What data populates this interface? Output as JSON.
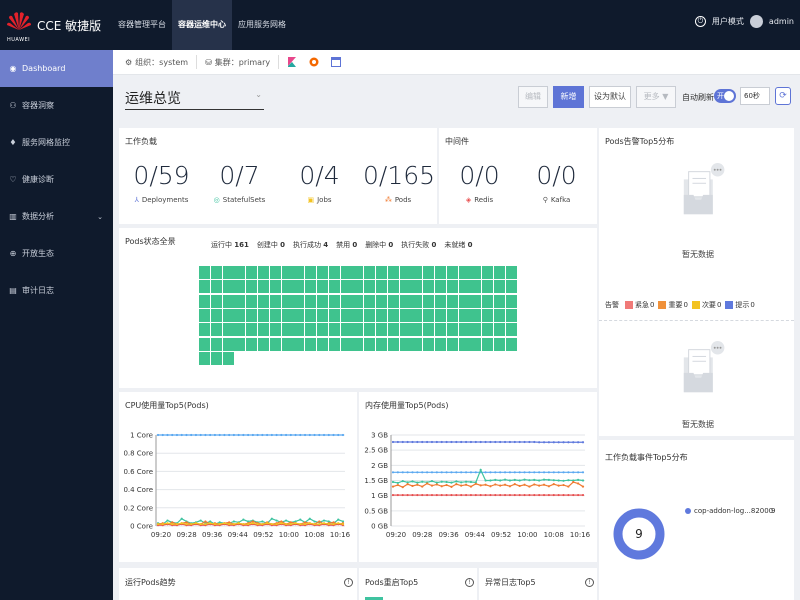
{
  "brand": {
    "logo_text": "HUAWEI",
    "title": "CCE 敏捷版"
  },
  "topnav": [
    {
      "label": "容器管理平台",
      "active": false
    },
    {
      "label": "容器运维中心",
      "active": true
    },
    {
      "label": "应用服务网格",
      "active": false
    }
  ],
  "top_right": {
    "user_mode": "用户模式",
    "username": "admin"
  },
  "sidebar": [
    {
      "label": "Dashboard",
      "icon": "dashboard-icon",
      "active": true
    },
    {
      "label": "容器洞察",
      "icon": "insight-icon"
    },
    {
      "label": "服务网格监控",
      "icon": "mesh-icon"
    },
    {
      "label": "健康诊断",
      "icon": "health-icon"
    },
    {
      "label": "数据分析",
      "icon": "chart-icon",
      "chevron": true
    },
    {
      "label": "开放生态",
      "icon": "ecosystem-icon"
    },
    {
      "label": "审计日志",
      "icon": "audit-icon"
    }
  ],
  "context": {
    "org": "组织：system",
    "cluster": "集群：primary"
  },
  "header": {
    "page_title": "运维总览",
    "edit": "编辑",
    "add": "新增",
    "set_default": "设为默认",
    "more": "更多",
    "auto_refresh": "自动刷新",
    "toggle": "开",
    "interval": "60秒"
  },
  "workload": {
    "title": "工作负载",
    "items": [
      {
        "value": "0/59",
        "label": "Deployments"
      },
      {
        "value": "0/7",
        "label": "StatefulSets"
      },
      {
        "value": "0/4",
        "label": "Jobs"
      },
      {
        "value": "0/165",
        "label": "Pods"
      }
    ]
  },
  "middleware": {
    "title": "中间件",
    "items": [
      {
        "value": "0/0",
        "label": "Redis"
      },
      {
        "value": "0/0",
        "label": "Kafka"
      }
    ]
  },
  "pod_status": {
    "title": "Pods状态全景",
    "stats": [
      {
        "label": "运行中",
        "value": "161"
      },
      {
        "label": "创建中",
        "value": "0"
      },
      {
        "label": "执行成功",
        "value": "4"
      },
      {
        "label": "禁用",
        "value": "0"
      },
      {
        "label": "删除中",
        "value": "0"
      },
      {
        "label": "执行失败",
        "value": "0"
      },
      {
        "label": "未就绪",
        "value": "0"
      }
    ],
    "pod_count": 165
  },
  "alarm_top5": {
    "title": "Pods告警Top5分布",
    "empty": "暂无数据",
    "legend_title": "告警",
    "legend": [
      {
        "label": "紧急",
        "value": "0",
        "color": "#f07a78"
      },
      {
        "label": "重要",
        "value": "0",
        "color": "#f0913a"
      },
      {
        "label": "次要",
        "value": "0",
        "color": "#f3c322"
      },
      {
        "label": "提示",
        "value": "0",
        "color": "#5f79dd"
      }
    ],
    "empty2": "暂无数据"
  },
  "cpu_chart_title": "CPU使用量Top5(Pods)",
  "mem_chart_title": "内存使用量Top5(Pods)",
  "event_top5": {
    "title": "工作负载事件Top5分布",
    "total": "9",
    "legend_label": "cop-addon-log...82000",
    "legend_value": "9"
  },
  "bottom": {
    "running_trend": "运行Pods趋势",
    "restart_top5": "Pods重启Top5",
    "error_log_top5": "异常日志Top5"
  },
  "chart_data": [
    {
      "type": "line",
      "title": "CPU使用量Top5(Pods)",
      "x": [
        "09:20",
        "09:28",
        "09:36",
        "09:44",
        "09:52",
        "10:00",
        "10:08",
        "10:16"
      ],
      "yticks": [
        "0 Core",
        "0.2 Core",
        "0.4 Core",
        "0.6 Core",
        "0.8 Core",
        "1 Core"
      ],
      "ylim": [
        0,
        1
      ],
      "series": [
        {
          "color": "#5aa8f0",
          "values": [
            1,
            1,
            1,
            1,
            1,
            1,
            1,
            1,
            1,
            1,
            1,
            1,
            1,
            1,
            1,
            1,
            1,
            1,
            1,
            1,
            1,
            1,
            1,
            1,
            1,
            1,
            1,
            1,
            1,
            1,
            1,
            1,
            1,
            1,
            1,
            1,
            1,
            1,
            1,
            1
          ]
        },
        {
          "color": "#3fc3a0",
          "values": [
            0.03,
            0.02,
            0.06,
            0.04,
            0.03,
            0.08,
            0.05,
            0.03,
            0.04,
            0.06,
            0.03,
            0.05,
            0.02,
            0.04,
            0.03,
            0.03,
            0.05,
            0.04,
            0.07,
            0.05,
            0.06,
            0.04,
            0.05,
            0.03,
            0.08,
            0.06,
            0.04,
            0.06,
            0.04,
            0.05,
            0.07,
            0.04,
            0.08,
            0.05,
            0.04,
            0.06,
            0.05,
            0.03,
            0.07,
            0.05
          ]
        },
        {
          "color": "#f07a30",
          "values": [
            0.02,
            0.03,
            0.02,
            0.04,
            0.02,
            0.03,
            0.04,
            0.02,
            0.03,
            0.02,
            0.05,
            0.02,
            0.03,
            0.02,
            0.03,
            0.04,
            0.02,
            0.03,
            0.02,
            0.03,
            0.05,
            0.03,
            0.02,
            0.04,
            0.02,
            0.03,
            0.05,
            0.02,
            0.04,
            0.03,
            0.02,
            0.04,
            0.03,
            0.02,
            0.05,
            0.02,
            0.03,
            0.04,
            0.02,
            0.03
          ]
        },
        {
          "color": "#e84c4c",
          "values": [
            0.01,
            0.01,
            0.02,
            0.01,
            0.01,
            0.02,
            0.01,
            0.01,
            0.02,
            0.01,
            0.01,
            0.02,
            0.01,
            0.01,
            0.02,
            0.01,
            0.01,
            0.02,
            0.01,
            0.01,
            0.02,
            0.01,
            0.01,
            0.02,
            0.01,
            0.01,
            0.02,
            0.01,
            0.01,
            0.02,
            0.01,
            0.01,
            0.02,
            0.01,
            0.01,
            0.02,
            0.01,
            0.01,
            0.02,
            0.01
          ]
        },
        {
          "color": "#f3c322",
          "values": [
            0.02,
            0.02,
            0.03,
            0.02,
            0.02,
            0.03,
            0.02,
            0.02,
            0.03,
            0.02,
            0.02,
            0.03,
            0.02,
            0.02,
            0.03,
            0.02,
            0.02,
            0.03,
            0.02,
            0.02,
            0.03,
            0.02,
            0.02,
            0.03,
            0.02,
            0.02,
            0.03,
            0.02,
            0.02,
            0.03,
            0.02,
            0.02,
            0.03,
            0.02,
            0.02,
            0.03,
            0.02,
            0.02,
            0.03,
            0.02
          ]
        }
      ]
    },
    {
      "type": "line",
      "title": "内存使用量Top5(Pods)",
      "x": [
        "09:20",
        "09:28",
        "09:36",
        "09:44",
        "09:52",
        "10:00",
        "10:08",
        "10:16"
      ],
      "yticks": [
        "0 GB",
        "0.5 GB",
        "1 GB",
        "1.5 GB",
        "2 GB",
        "2.5 GB",
        "3 GB"
      ],
      "ylim": [
        0,
        3
      ],
      "series": [
        {
          "color": "#5f79dd",
          "values": [
            2.77,
            2.77,
            2.77,
            2.77,
            2.77,
            2.77,
            2.77,
            2.77,
            2.77,
            2.77,
            2.77,
            2.77,
            2.77,
            2.77,
            2.77,
            2.77,
            2.77,
            2.77,
            2.77,
            2.77,
            2.77,
            2.77,
            2.77,
            2.77,
            2.77,
            2.77,
            2.77,
            2.77,
            2.77,
            2.77,
            2.76,
            2.76,
            2.76,
            2.76,
            2.76,
            2.76,
            2.76,
            2.76,
            2.76,
            2.76
          ]
        },
        {
          "color": "#5aa8f0",
          "values": [
            1.77,
            1.77,
            1.77,
            1.77,
            1.77,
            1.77,
            1.77,
            1.77,
            1.77,
            1.77,
            1.77,
            1.77,
            1.77,
            1.77,
            1.77,
            1.77,
            1.77,
            1.77,
            1.77,
            1.77,
            1.77,
            1.77,
            1.77,
            1.77,
            1.77,
            1.77,
            1.77,
            1.77,
            1.77,
            1.77,
            1.77,
            1.77,
            1.77,
            1.77,
            1.77,
            1.77,
            1.77,
            1.77,
            1.77,
            1.77
          ]
        },
        {
          "color": "#3fc3a0",
          "values": [
            1.45,
            1.42,
            1.48,
            1.44,
            1.47,
            1.43,
            1.46,
            1.44,
            1.48,
            1.43,
            1.46,
            1.45,
            1.43,
            1.47,
            1.44,
            1.46,
            1.45,
            1.44,
            1.85,
            1.5,
            1.5,
            1.52,
            1.5,
            1.53,
            1.5,
            1.52,
            1.5,
            1.53,
            1.51,
            1.52,
            1.5,
            1.53,
            1.52,
            1.51,
            1.5,
            1.49,
            1.51,
            1.5,
            1.52,
            1.5
          ]
        },
        {
          "color": "#f07a30",
          "values": [
            1.3,
            1.35,
            1.28,
            1.38,
            1.32,
            1.36,
            1.3,
            1.4,
            1.33,
            1.37,
            1.31,
            1.35,
            1.29,
            1.38,
            1.33,
            1.36,
            1.3,
            1.39,
            1.34,
            1.36,
            1.31,
            1.37,
            1.33,
            1.36,
            1.31,
            1.38,
            1.32,
            1.36,
            1.3,
            1.37,
            1.33,
            1.36,
            1.31,
            1.38,
            1.33,
            1.35,
            1.3,
            1.45,
            1.4,
            1.3
          ]
        },
        {
          "color": "#e84c4c",
          "values": [
            1.02,
            1.02,
            1.02,
            1.02,
            1.02,
            1.02,
            1.02,
            1.02,
            1.02,
            1.02,
            1.02,
            1.02,
            1.02,
            1.02,
            1.02,
            1.02,
            1.02,
            1.02,
            1.02,
            1.02,
            1.02,
            1.02,
            1.02,
            1.02,
            1.02,
            1.02,
            1.02,
            1.02,
            1.02,
            1.02,
            1.02,
            1.02,
            1.02,
            1.02,
            1.02,
            1.02,
            1.02,
            1.02,
            1.02,
            1.02
          ]
        }
      ]
    },
    {
      "type": "pie",
      "title": "工作负载事件Top5分布",
      "categories": [
        "cop-addon-log...82000"
      ],
      "values": [
        9
      ]
    }
  ]
}
